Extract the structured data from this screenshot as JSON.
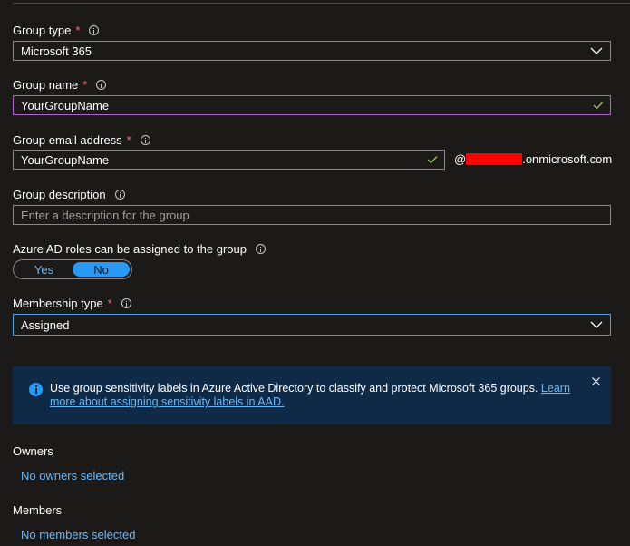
{
  "group_type": {
    "label": "Group type",
    "required_mark": "*",
    "value": "Microsoft 365"
  },
  "group_name": {
    "label": "Group name",
    "required_mark": "*",
    "value": "YourGroupName"
  },
  "group_email": {
    "label": "Group email address",
    "required_mark": "*",
    "value": "YourGroupName",
    "at_sign": "@",
    "domain_suffix": ".onmicrosoft.com"
  },
  "group_description": {
    "label": "Group description",
    "placeholder": "Enter a description for the group"
  },
  "azure_ad_roles": {
    "label": "Azure AD roles can be assigned to the group",
    "yes_label": "Yes",
    "no_label": "No",
    "selected": "No"
  },
  "membership_type": {
    "label": "Membership type",
    "required_mark": "*",
    "value": "Assigned"
  },
  "banner": {
    "text": "Use group sensitivity labels in Azure Active Directory to classify and protect Microsoft 365 groups.",
    "link_text": "Learn more about assigning sensitivity labels in AAD."
  },
  "owners": {
    "label": "Owners",
    "link": "No owners selected"
  },
  "members": {
    "label": "Members",
    "link": "No members selected"
  },
  "colors": {
    "background": "#1b1a19",
    "accent": "#2899f5",
    "link": "#6cb8f6",
    "required": "#f1707b",
    "valid_check": "#92c353",
    "banner_background": "#0e2a47",
    "redaction": "#ff0000"
  }
}
